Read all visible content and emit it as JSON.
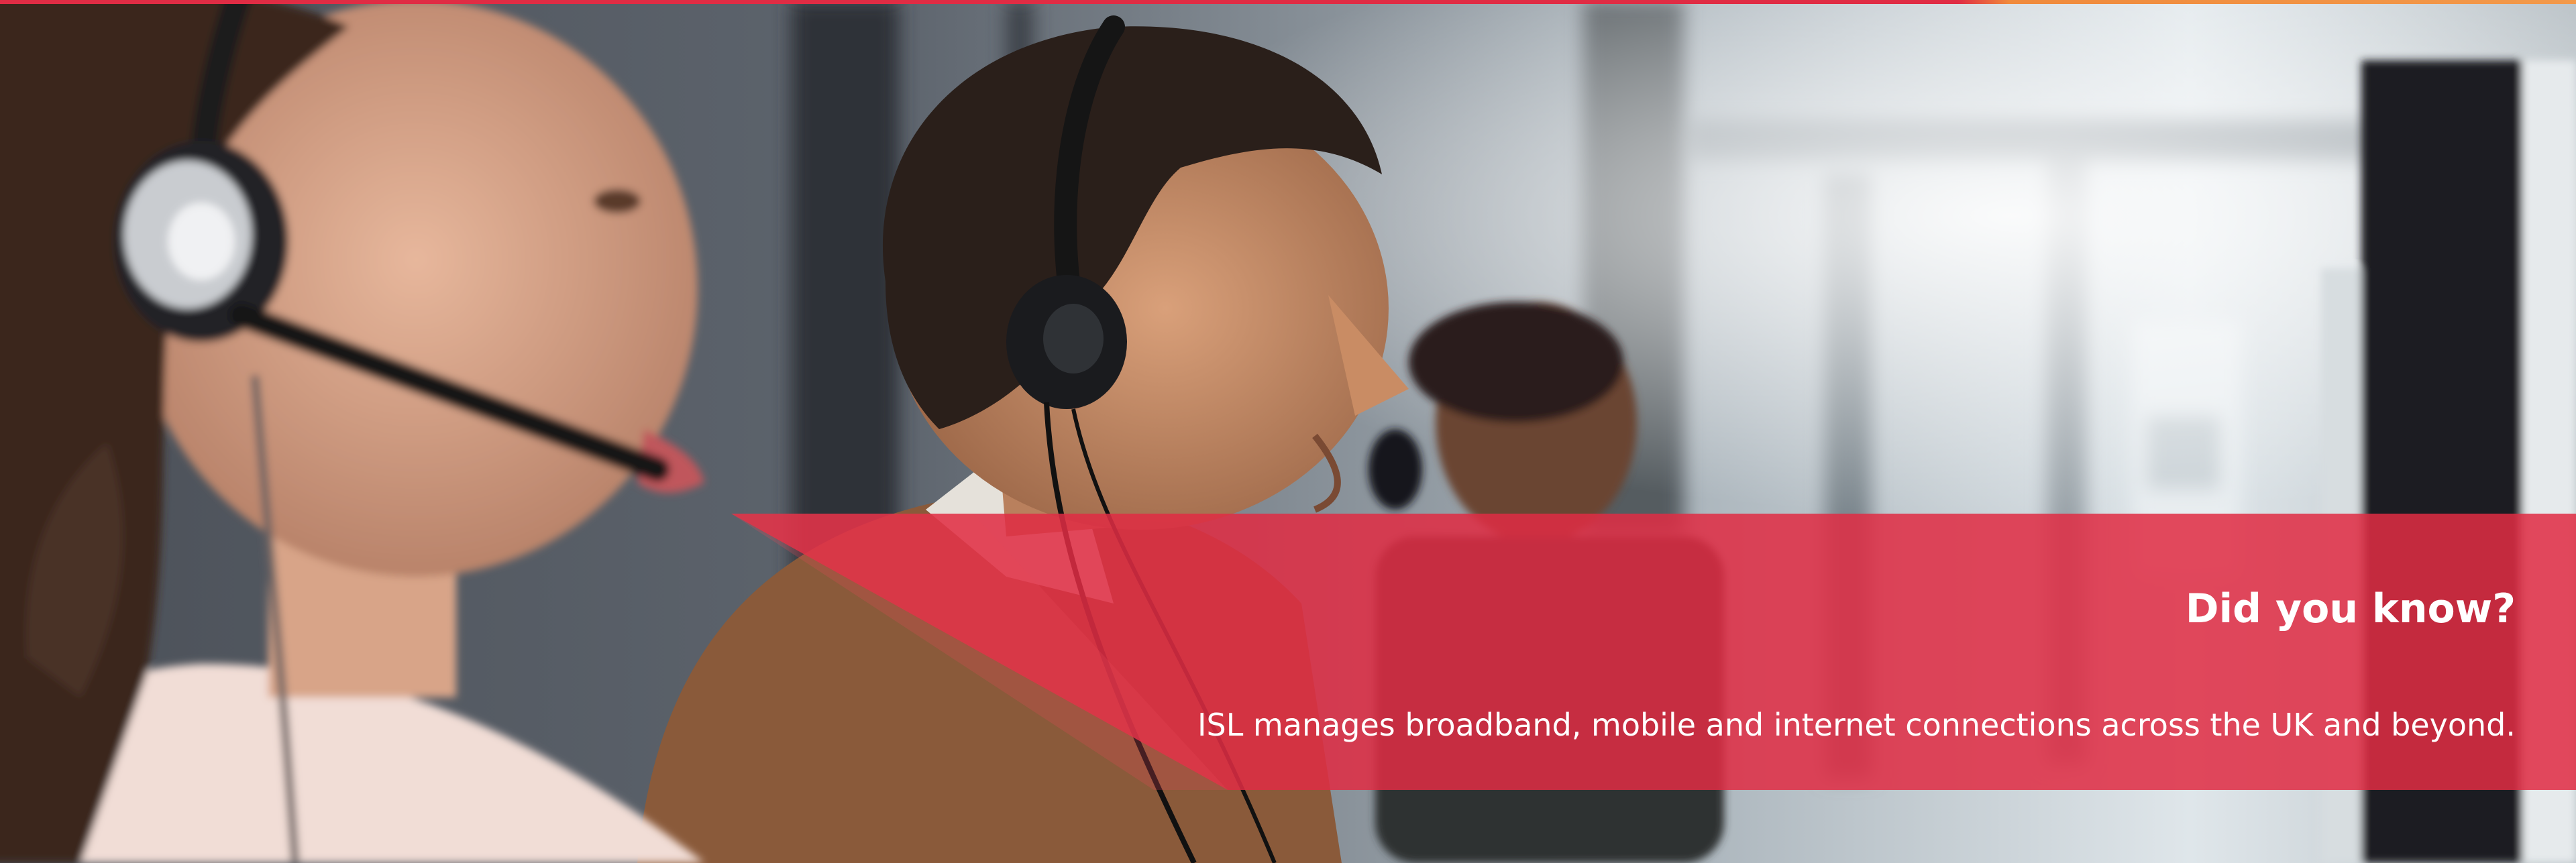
{
  "banner": {
    "title": "Did you know?",
    "text": "ISL manages broadband, mobile and internet connections across the UK and beyond."
  },
  "colors": {
    "brand_red": "#e02c44",
    "accent_orange": "#f2994a",
    "text": "#ffffff"
  }
}
